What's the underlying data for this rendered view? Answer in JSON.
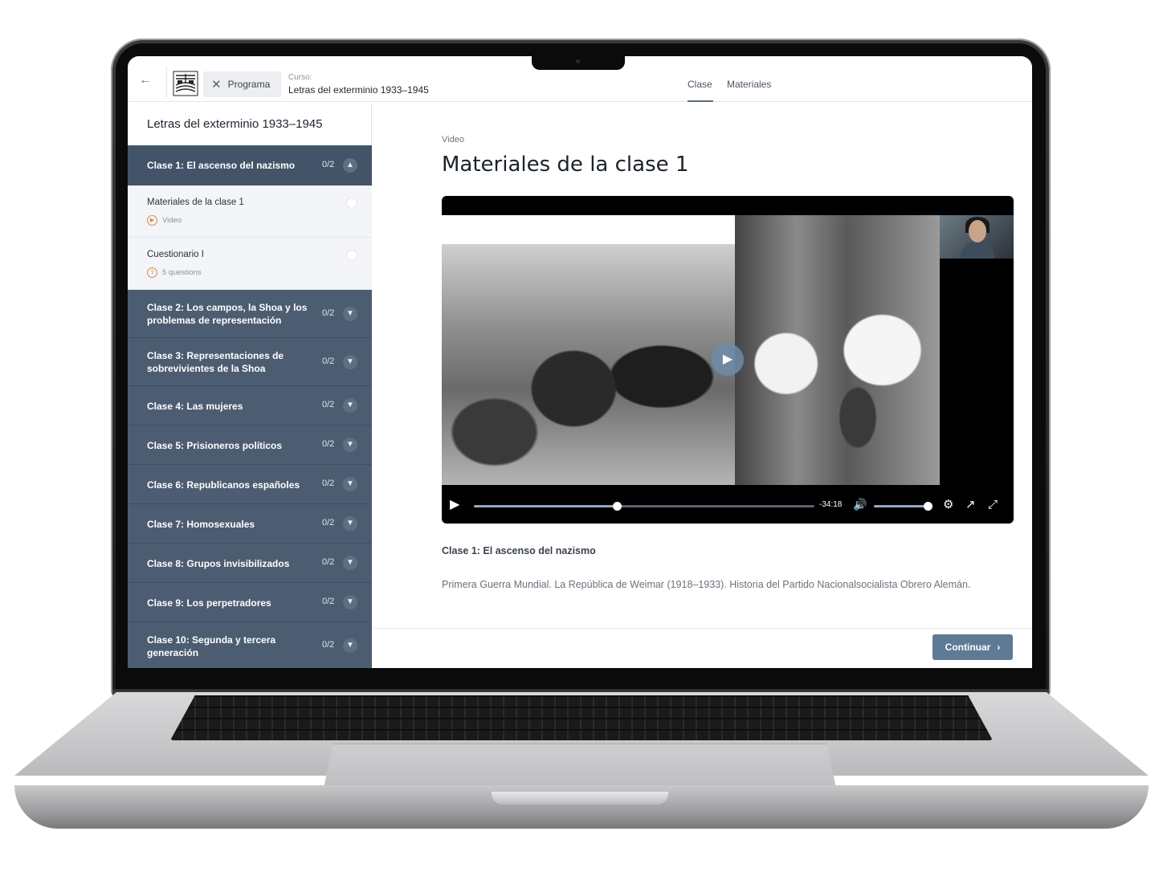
{
  "header": {
    "back_icon": "arrow-left-icon",
    "programa_label": "Programa",
    "course_kicker": "Curso:",
    "course_title": "Letras del exterminio 1933–1945",
    "tabs": [
      {
        "label": "Clase",
        "active": true
      },
      {
        "label": "Materiales",
        "active": false
      }
    ]
  },
  "sidebar": {
    "title": "Letras del exterminio 1933–1945",
    "active_module": {
      "label": "Clase 1: El ascenso del nazismo",
      "count": "0/2",
      "lessons": [
        {
          "title": "Materiales de la clase 1",
          "type": "Video",
          "icon": "play-circle-icon"
        },
        {
          "title": "Cuestionario I",
          "type": "5 questions",
          "icon": "question-circle-icon"
        }
      ]
    },
    "modules": [
      {
        "label": "Clase 2: Los campos, la Shoa y los problemas de representación",
        "count": "0/2"
      },
      {
        "label": "Clase 3: Representaciones de sobrevivientes de la Shoa",
        "count": "0/2"
      },
      {
        "label": "Clase 4: Las mujeres",
        "count": "0/2"
      },
      {
        "label": "Clase 5: Prisioneros políticos",
        "count": "0/2"
      },
      {
        "label": "Clase 6: Republicanos españoles",
        "count": "0/2"
      },
      {
        "label": "Clase 7: Homosexuales",
        "count": "0/2"
      },
      {
        "label": "Clase 8: Grupos invisibilizados",
        "count": "0/2"
      },
      {
        "label": "Clase 9: Los perpetradores",
        "count": "0/2"
      },
      {
        "label": "Clase 10: Segunda y tercera generación",
        "count": "0/2"
      }
    ]
  },
  "main": {
    "kicker": "Video",
    "title": "Materiales de la clase 1",
    "player": {
      "time_remaining": "-34:18",
      "progress_fraction": 0.42,
      "volume_fraction": 0.95
    },
    "section_label": "Clase 1: El ascenso del nazismo",
    "description": "Primera Guerra Mundial. La República de Weimar (1918–1933). Historia del Partido Nacionalsocialista Obrero Alemán.",
    "continue_label": "Continuar"
  },
  "colors": {
    "sidebar_module_bg": "#4c5d72",
    "accent_button": "#5f7a94",
    "lesson_icon": "#d98a4a"
  }
}
